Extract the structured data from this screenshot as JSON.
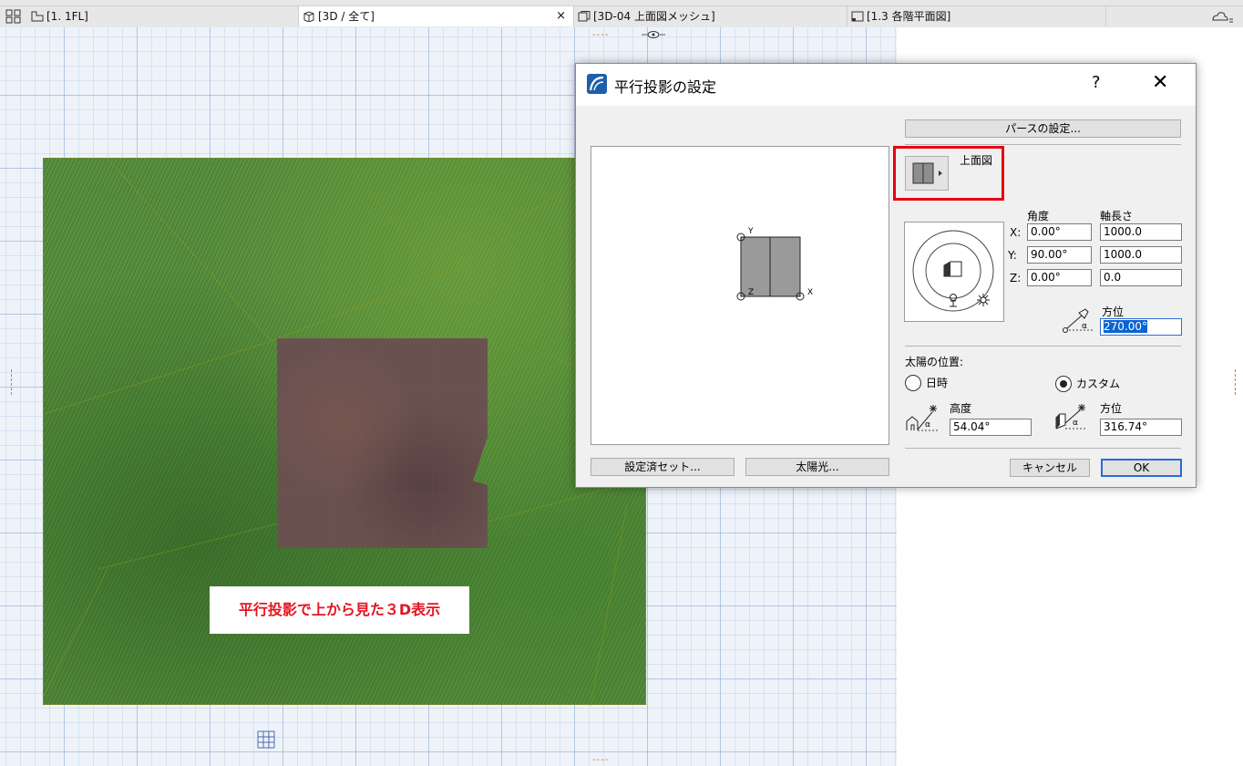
{
  "tabs": [
    {
      "label": "[1. 1FL]",
      "active": false
    },
    {
      "label": "[3D / 全て]",
      "active": true,
      "close": "×"
    },
    {
      "label": "[3D-04 上面図メッシュ]",
      "active": false
    },
    {
      "label": "[1.3 各階平面図]",
      "active": false
    }
  ],
  "canvas": {
    "caption": "平行投影で上から見た３D表示"
  },
  "dialog": {
    "title": "平行投影の設定",
    "help": "?",
    "close": "✕",
    "perspective_button": "パースの設定...",
    "view_type_label": "上面図",
    "preview_axis_y": "Y",
    "preview_axis_x": "X",
    "preview_axis_z": "Z",
    "col_angle": "角度",
    "col_axis_length": "軸長さ",
    "rows": [
      {
        "axis": "X:",
        "angle": "0.00°",
        "length": "1000.0"
      },
      {
        "axis": "Y:",
        "angle": "90.00°",
        "length": "1000.0"
      },
      {
        "axis": "Z:",
        "angle": "0.00°",
        "length": "0.0"
      }
    ],
    "azimuth_label": "方位",
    "azimuth_value": "270.00°",
    "sun_position_label": "太陽の位置:",
    "radio_datetime": "日時",
    "radio_custom": "カスタム",
    "sun_altitude_label": "高度",
    "sun_altitude_value": "54.04°",
    "sun_azimuth_label": "方位",
    "sun_azimuth_value": "316.74°",
    "preset_button": "設定済セット...",
    "sunlight_button": "太陽光...",
    "cancel_button": "キャンセル",
    "ok_button": "OK"
  },
  "colors": {
    "highlight_red": "#e60012",
    "caption_red": "#e4141f",
    "selection_blue": "#0a64d2"
  }
}
